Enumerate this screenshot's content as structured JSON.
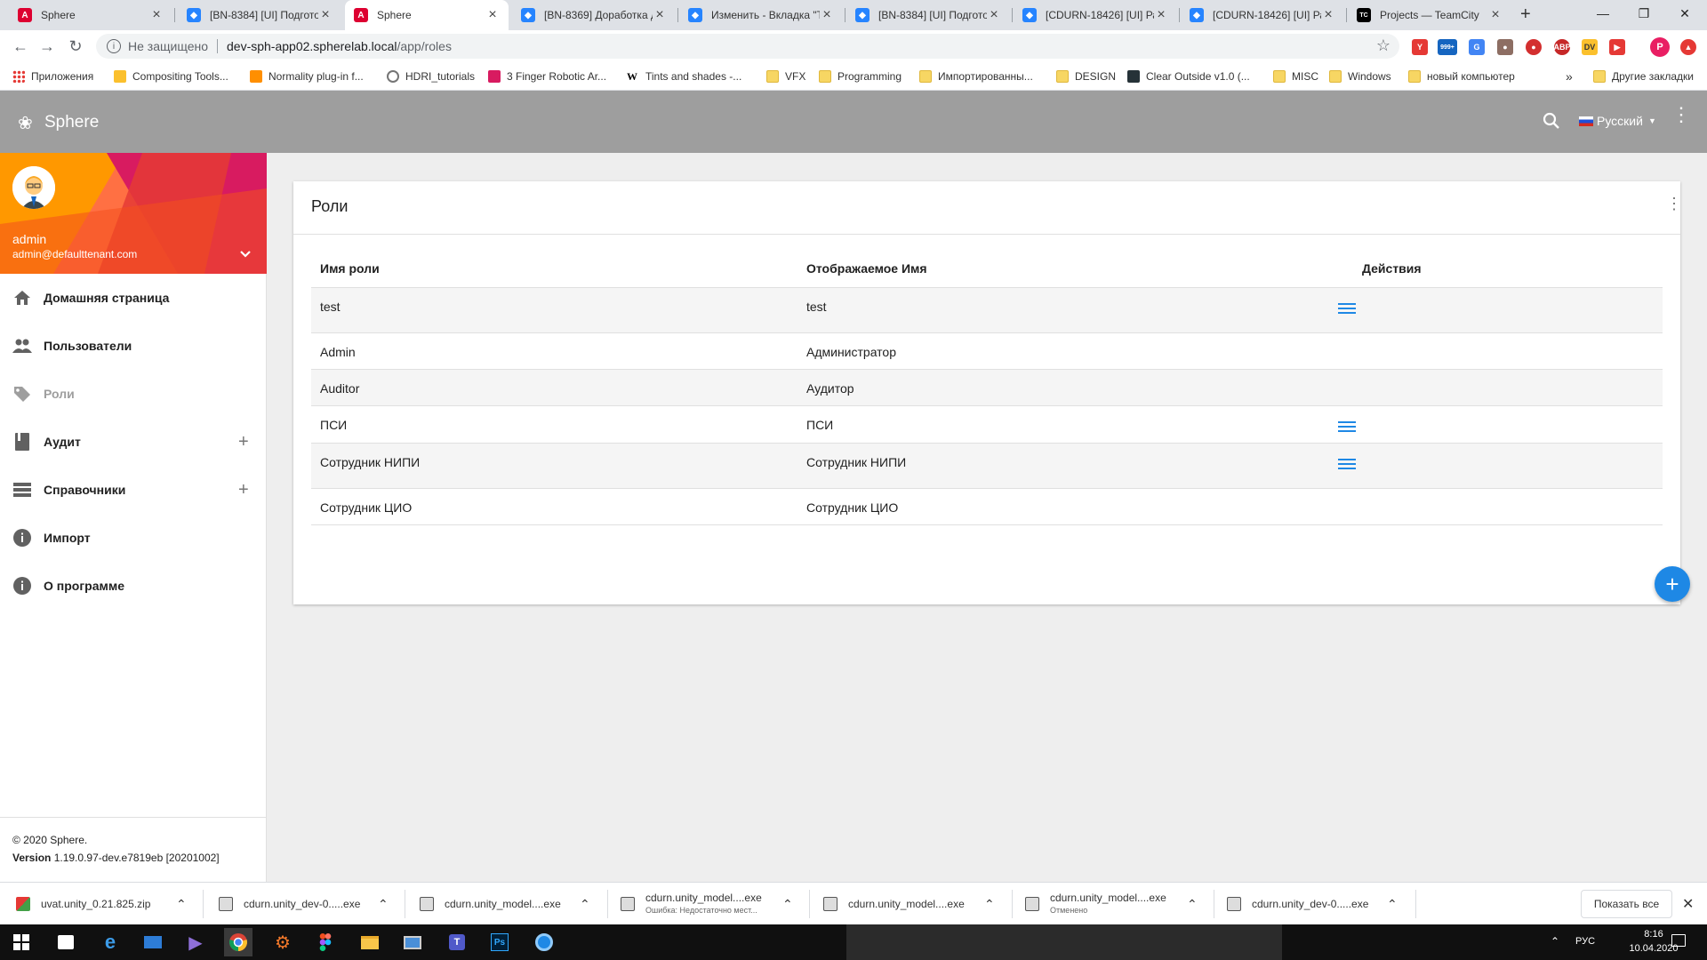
{
  "browser": {
    "tabs": [
      {
        "title": "Sphere",
        "icon": "angular-icon",
        "color": "#dd0031",
        "active": false
      },
      {
        "title": "[BN-8384] [UI] Подгото",
        "icon": "jira-icon",
        "color": "#2684ff",
        "active": false
      },
      {
        "title": "Sphere",
        "icon": "angular-icon",
        "color": "#dd0031",
        "active": true
      },
      {
        "title": "[BN-8369] Доработка д",
        "icon": "jira-icon",
        "color": "#2684ff",
        "active": false
      },
      {
        "title": "Изменить - Вкладка \"Т",
        "icon": "confluence-icon",
        "color": "#2684ff",
        "active": false
      },
      {
        "title": "[BN-8384] [UI] Подгото",
        "icon": "jira-icon",
        "color": "#2684ff",
        "active": false
      },
      {
        "title": "[CDURN-18426] [UI] Ра",
        "icon": "jira-icon",
        "color": "#2684ff",
        "active": false
      },
      {
        "title": "[CDURN-18426] [UI] Ра",
        "icon": "jira-icon",
        "color": "#2684ff",
        "active": false
      },
      {
        "title": "Projects — TeamCity",
        "icon": "teamcity-icon",
        "color": "#000000",
        "active": false
      }
    ],
    "new_tab": "+",
    "security_label": "Не защищено",
    "url_host": "dev-sph-app02.spherelab.local",
    "url_path": "/app/roles",
    "ext_badge": "999+",
    "profile_letter": "P",
    "bookmarks": [
      {
        "label": "Приложения",
        "icon": "apps-icon"
      },
      {
        "label": "Compositing Tools...",
        "icon": "site-icon"
      },
      {
        "label": "Normality plug-in f...",
        "icon": "site-icon"
      },
      {
        "label": "HDRI_tutorials",
        "icon": "search-icon"
      },
      {
        "label": "3 Finger Robotic Ar...",
        "icon": "site-icon"
      },
      {
        "label": "Tints and shades -...",
        "icon": "wikipedia-icon"
      },
      {
        "label": "VFX",
        "icon": "folder-icon"
      },
      {
        "label": "Programming",
        "icon": "folder-icon"
      },
      {
        "label": "Импортированны...",
        "icon": "folder-icon"
      },
      {
        "label": "DESIGN",
        "icon": "folder-icon"
      },
      {
        "label": "Clear Outside v1.0 (...",
        "icon": "site-icon"
      },
      {
        "label": "MISC",
        "icon": "folder-icon"
      },
      {
        "label": "Windows",
        "icon": "folder-icon"
      },
      {
        "label": "новый компьютер",
        "icon": "folder-icon"
      }
    ],
    "bookmarks_more": "»",
    "other_bookmarks": "Другие закладки"
  },
  "app": {
    "brand": "Sphere",
    "language": "Русский",
    "accent": "#1e88e5",
    "header_color": "#9e9e9e"
  },
  "user": {
    "name": "admin",
    "email": "admin@defaulttenant.com"
  },
  "nav": [
    {
      "label": "Домашняя страница",
      "icon": "home-icon",
      "expandable": false,
      "active": false
    },
    {
      "label": "Пользователи",
      "icon": "users-icon",
      "expandable": false,
      "active": false
    },
    {
      "label": "Роли",
      "icon": "tag-icon",
      "expandable": false,
      "active": true
    },
    {
      "label": "Аудит",
      "icon": "book-icon",
      "expandable": true,
      "active": false
    },
    {
      "label": "Справочники",
      "icon": "list-icon",
      "expandable": true,
      "active": false
    },
    {
      "label": "Импорт",
      "icon": "info-icon",
      "expandable": false,
      "active": false
    },
    {
      "label": "О программе",
      "icon": "info-icon",
      "expandable": false,
      "active": false
    }
  ],
  "nav_plus": "+",
  "footer": {
    "copyright": "© 2020 Sphere.",
    "version_label": "Version",
    "version_value": "1.19.0.97-dev.e7819eb [20201002]"
  },
  "roles": {
    "title": "Роли",
    "columns": [
      "Имя роли",
      "Отображаемое Имя",
      "Действия"
    ],
    "rows": [
      {
        "name": "test",
        "display": "test",
        "has_actions": true
      },
      {
        "name": "Admin",
        "display": "Администратор",
        "has_actions": false
      },
      {
        "name": "Auditor",
        "display": "Аудитор",
        "has_actions": false
      },
      {
        "name": "ПСИ",
        "display": "ПСИ",
        "has_actions": true
      },
      {
        "name": "Сотрудник НИПИ",
        "display": "Сотрудник НИПИ",
        "has_actions": true
      },
      {
        "name": "Сотрудник ЦИО",
        "display": "Сотрудник ЦИО",
        "has_actions": false
      }
    ],
    "add": "+"
  },
  "downloads": {
    "items": [
      {
        "name": "uvat.unity_0.21.825.zip",
        "status": ""
      },
      {
        "name": "cdurn.unity_dev-0.....exe",
        "status": ""
      },
      {
        "name": "cdurn.unity_model....exe",
        "status": ""
      },
      {
        "name": "cdurn.unity_model....exe",
        "status": "Ошибка: Недостаточно мест..."
      },
      {
        "name": "cdurn.unity_model....exe",
        "status": ""
      },
      {
        "name": "cdurn.unity_model....exe",
        "status": "Отменено"
      },
      {
        "name": "cdurn.unity_dev-0.....exe",
        "status": ""
      }
    ],
    "show_all": "Показать все"
  },
  "taskbar": {
    "lang": "РУС",
    "time": "8:16",
    "date": "10.04.2020"
  }
}
